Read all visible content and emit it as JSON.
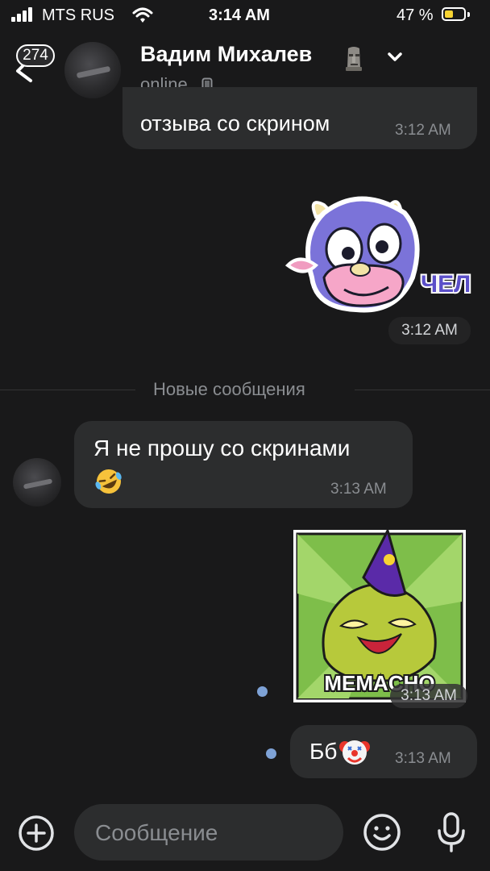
{
  "status_bar": {
    "carrier": "MTS RUS",
    "time": "3:14 AM",
    "battery_percent": "47 %",
    "battery_level": 0.47
  },
  "header": {
    "unread_count": "274",
    "contact_name": "Вадим Михалев",
    "status": "online"
  },
  "messages": {
    "msg1": {
      "text": "отзыва со скрином",
      "time": "3:12 AM"
    },
    "sticker1": {
      "caption": "ЧЕЛ",
      "time": "3:12 AM"
    },
    "new_messages_label": "Новые сообщения",
    "msg2": {
      "text": "Я не прошу со скринами",
      "time": "3:13 AM"
    },
    "sticker2": {
      "caption": "MEMACHO",
      "time": "3:13 AM"
    },
    "msg3": {
      "text": "Бб",
      "time": "3:13 AM"
    }
  },
  "composer": {
    "placeholder": "Сообщение"
  },
  "colors": {
    "background": "#19191a",
    "bubble": "#2c2d2e",
    "secondary_text": "#8a8d91",
    "unread_dot": "#7ea2d6",
    "battery": "#f7d332"
  },
  "icons": [
    "signal-icon",
    "wifi-icon",
    "battery-icon",
    "back-icon",
    "moai-emoji-icon",
    "chevron-down-icon",
    "phone-icon",
    "rofl-emoji-icon",
    "clown-emoji-icon",
    "plus-icon",
    "smile-icon",
    "microphone-icon"
  ]
}
